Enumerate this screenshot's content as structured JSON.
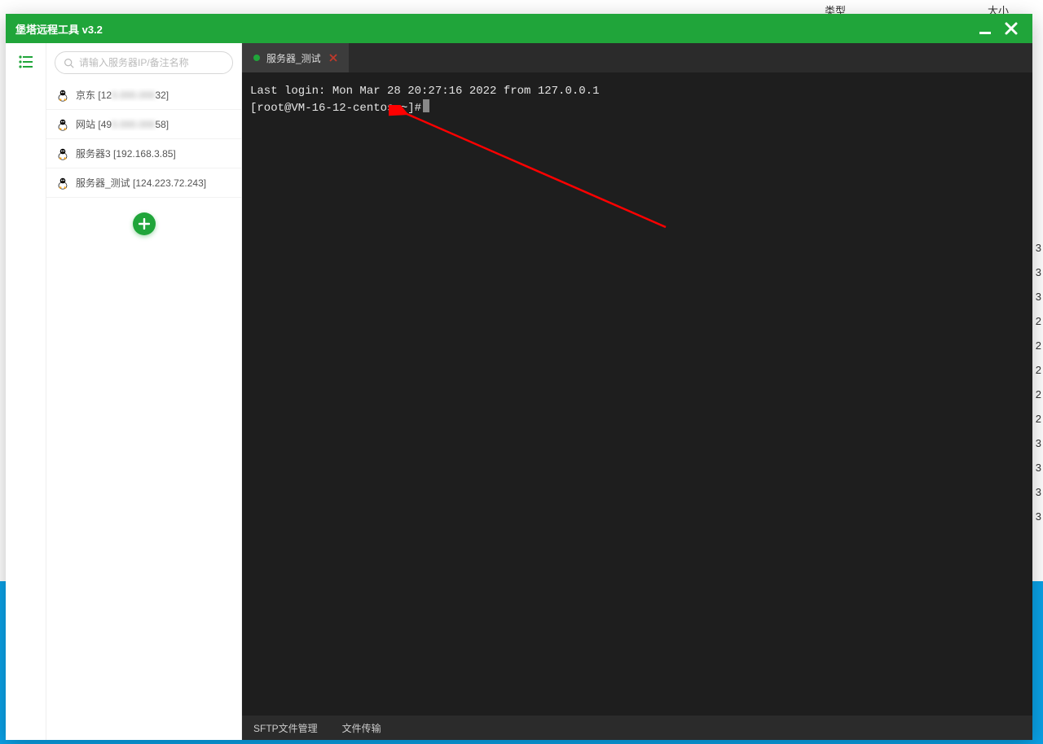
{
  "bg": {
    "header_type": "类型",
    "header_size": "大小",
    "right_values": [
      "3",
      "3",
      "3",
      "2",
      "2",
      "2",
      "2",
      "2",
      "3",
      "3",
      "3",
      "3"
    ]
  },
  "title": "堡塔远程工具 v3.2",
  "search": {
    "placeholder": "请输入服务器IP/备注名称"
  },
  "servers": [
    {
      "name": "京东",
      "ip_prefix": "[12",
      "ip_blur": "0.000.000",
      "ip_suffix": "32]"
    },
    {
      "name": "网站",
      "ip_prefix": "[49",
      "ip_blur": "0.000.000",
      "ip_suffix": "58]"
    },
    {
      "name": "服务器3",
      "ip_prefix": "[192.168.3.85]",
      "ip_blur": "",
      "ip_suffix": ""
    },
    {
      "name": "服务器_测试",
      "ip_prefix": "[124.223.72.243]",
      "ip_blur": "",
      "ip_suffix": ""
    }
  ],
  "tab": {
    "label": "服务器_测试"
  },
  "terminal": {
    "line1": "Last login: Mon Mar 28 20:27:16 2022 from 127.0.0.1",
    "line2": "[root@VM-16-12-centos ~]#"
  },
  "statusbar": {
    "sftp": "SFTP文件管理",
    "transfer": "文件传输"
  },
  "colors": {
    "brand": "#20a53a",
    "term_bg": "#1e1e1e"
  }
}
